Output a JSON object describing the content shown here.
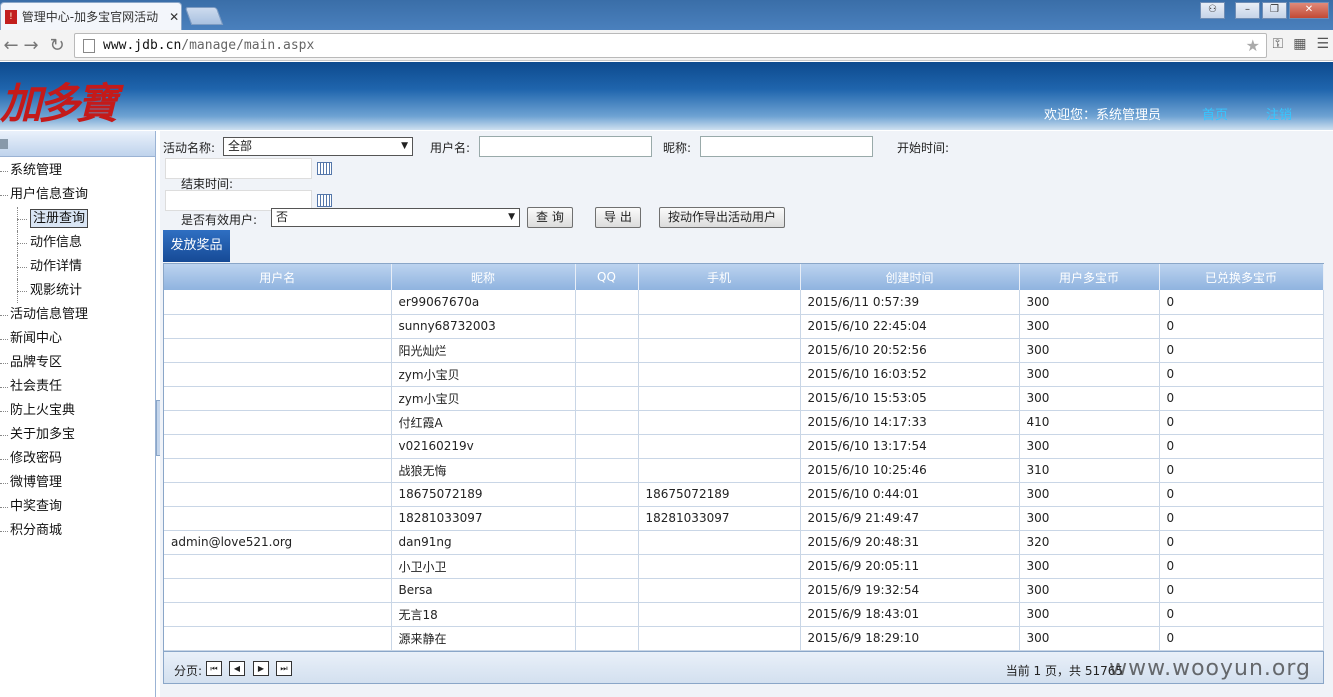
{
  "browser": {
    "tab_title": "管理中心-加多宝官网活动",
    "tab_close": "✕",
    "url_host": "www.jdb.cn",
    "url_path": "/manage/main.aspx"
  },
  "header": {
    "logo": "加多寶",
    "welcome": "欢迎您：系统管理员",
    "home_link": "首页",
    "logout_link": "注销"
  },
  "sidebar": {
    "items": [
      {
        "label": "系统管理"
      },
      {
        "label": "用户信息查询"
      },
      {
        "label": "注册查询"
      },
      {
        "label": "动作信息"
      },
      {
        "label": "动作详情"
      },
      {
        "label": "观影统计"
      },
      {
        "label": "活动信息管理"
      },
      {
        "label": "新闻中心"
      },
      {
        "label": "品牌专区"
      },
      {
        "label": "社会责任"
      },
      {
        "label": "防上火宝典"
      },
      {
        "label": "关于加多宝"
      },
      {
        "label": "修改密码"
      },
      {
        "label": "微博管理"
      },
      {
        "label": "中奖查询"
      },
      {
        "label": "积分商城"
      }
    ]
  },
  "filters": {
    "activity_label": "活动名称:",
    "activity_value": "全部",
    "username_label": "用户名:",
    "nickname_label": "昵称:",
    "start_label": "开始时间:",
    "end_label": "结束时间:",
    "valid_label": "是否有效用户:",
    "valid_value": "否",
    "query_btn": "查 询",
    "export_btn": "导 出",
    "export_action_btn": "按动作导出活动用户",
    "prize_btn": "发放奖品"
  },
  "table": {
    "columns": [
      "用户名",
      "昵称",
      "QQ",
      "手机",
      "创建时间",
      "用户多宝币",
      "已兑换多宝币"
    ],
    "rows": [
      [
        "",
        "er99067670a",
        "",
        "",
        "2015/6/11 0:57:39",
        "300",
        "0"
      ],
      [
        "",
        "sunny68732003",
        "",
        "",
        "2015/6/10 22:45:04",
        "300",
        "0"
      ],
      [
        "",
        "阳光灿烂",
        "",
        "",
        "2015/6/10 20:52:56",
        "300",
        "0"
      ],
      [
        "",
        "zym小宝贝",
        "",
        "",
        "2015/6/10 16:03:52",
        "300",
        "0"
      ],
      [
        "",
        "zym小宝贝",
        "",
        "",
        "2015/6/10 15:53:05",
        "300",
        "0"
      ],
      [
        "",
        "付红霞A",
        "",
        "",
        "2015/6/10 14:17:33",
        "410",
        "0"
      ],
      [
        "",
        "v02160219v",
        "",
        "",
        "2015/6/10 13:17:54",
        "300",
        "0"
      ],
      [
        "",
        "战狼无悔",
        "",
        "",
        "2015/6/10 10:25:46",
        "310",
        "0"
      ],
      [
        "",
        "18675072189",
        "",
        "18675072189",
        "2015/6/10 0:44:01",
        "300",
        "0"
      ],
      [
        "",
        "18281033097",
        "",
        "18281033097",
        "2015/6/9 21:49:47",
        "300",
        "0"
      ],
      [
        "admin@love521.org",
        "dan91ng",
        "",
        "",
        "2015/6/9 20:48:31",
        "320",
        "0"
      ],
      [
        "",
        "小卫小卫",
        "",
        "",
        "2015/6/9 20:05:11",
        "300",
        "0"
      ],
      [
        "",
        "Bersa",
        "",
        "",
        "2015/6/9 19:32:54",
        "300",
        "0"
      ],
      [
        "",
        "无言18",
        "",
        "",
        "2015/6/9 18:43:01",
        "300",
        "0"
      ],
      [
        "",
        "源来静在",
        "",
        "",
        "2015/6/9 18:29:10",
        "300",
        "0"
      ]
    ]
  },
  "pager": {
    "label": "分页:",
    "info": "当前 1 页，共 51765",
    "watermark": "www.wooyun.org"
  },
  "icons": {
    "first": "⏮",
    "prev": "◀",
    "next": "▶",
    "last": "⏭"
  }
}
